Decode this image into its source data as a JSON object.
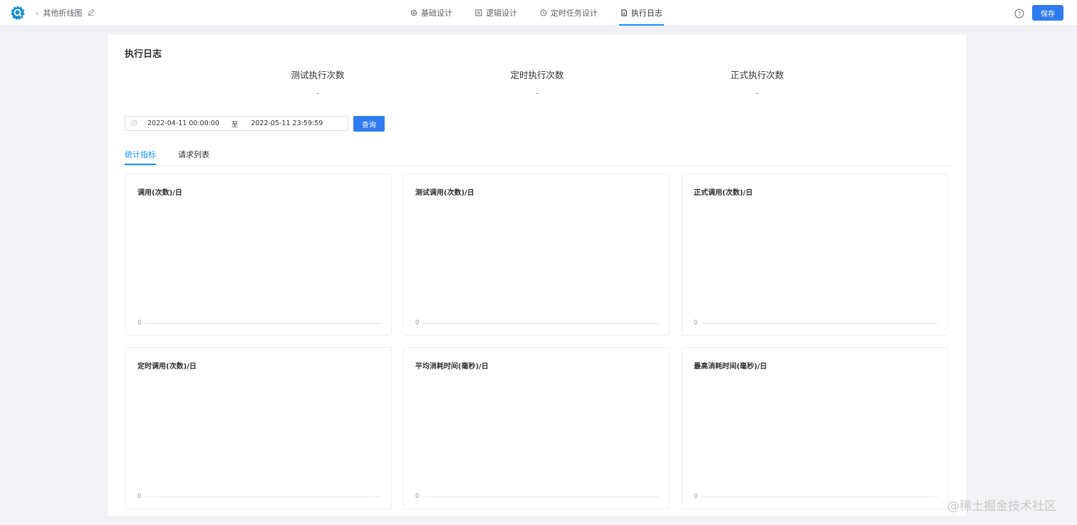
{
  "header": {
    "breadcrumb": "其他折线图",
    "tabs": [
      {
        "label": "基础设计",
        "icon": "gear-icon"
      },
      {
        "label": "逻辑设计",
        "icon": "logic-icon"
      },
      {
        "label": "定时任务设计",
        "icon": "clock-icon"
      },
      {
        "label": "执行日志",
        "icon": "document-icon",
        "active": true
      }
    ],
    "save_label": "保存"
  },
  "panel": {
    "title": "执行日志",
    "stats": [
      {
        "label": "测试执行次数",
        "value": "-"
      },
      {
        "label": "定时执行次数",
        "value": "-"
      },
      {
        "label": "正式执行次数",
        "value": "-"
      }
    ],
    "date_range": {
      "start": "2022-04-11 00:00:00",
      "separator": "至",
      "end": "2022-05-11 23:59:59"
    },
    "query_label": "查询",
    "subtabs": [
      {
        "label": "统计指标",
        "active": true
      },
      {
        "label": "请求列表",
        "active": false
      }
    ],
    "charts": [
      {
        "title": "调用(次数)/日",
        "zero": "0"
      },
      {
        "title": "测试调用(次数)/日",
        "zero": "0"
      },
      {
        "title": "正式调用(次数)/日",
        "zero": "0"
      },
      {
        "title": "定时调用(次数)/日",
        "zero": "0"
      },
      {
        "title": "平均消耗时间(毫秒)/日",
        "zero": "0"
      },
      {
        "title": "最高消耗时间(毫秒)/日",
        "zero": "0"
      }
    ]
  },
  "watermark": "@稀土掘金技术社区",
  "colors": {
    "accent": "#2f7bf0",
    "active_tab": "#1890ff",
    "background": "#f0f2f5"
  }
}
